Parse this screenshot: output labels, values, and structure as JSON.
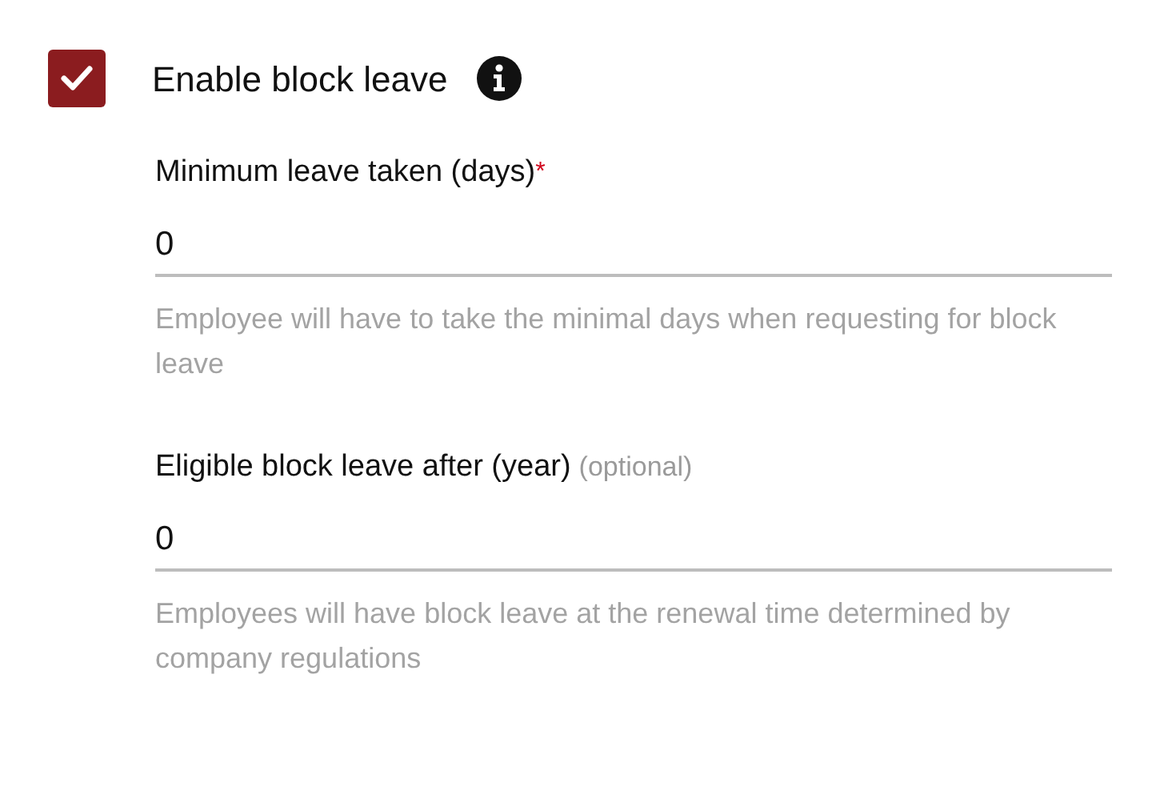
{
  "checkbox": {
    "label": "Enable block leave",
    "checked": true
  },
  "fields": [
    {
      "label": "Minimum leave taken (days)",
      "required_mark": "*",
      "value": "0",
      "helper": "Employee will have to take the minimal days when requesting for block leave"
    },
    {
      "label": "Eligible block leave after (year)",
      "optional_note": "(optional)",
      "value": "0",
      "helper": "Employees will have block leave at the renewal time determined by company regulations"
    }
  ]
}
